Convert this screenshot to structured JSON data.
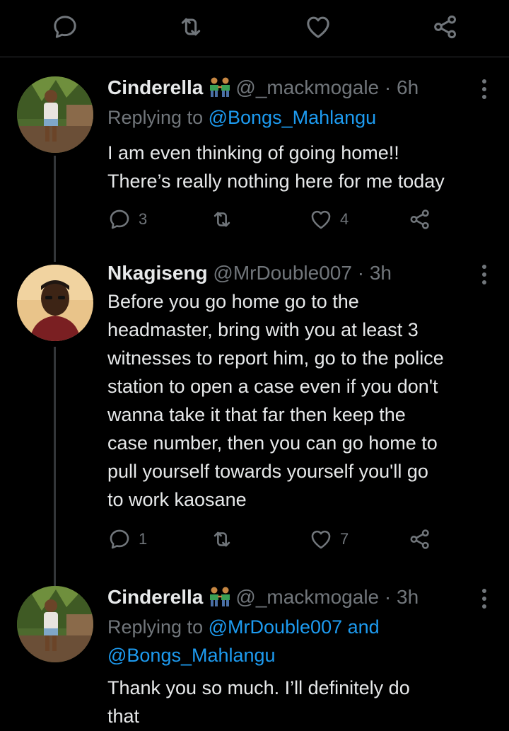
{
  "theme": {
    "background": "#000000",
    "text": "#e7e9ea",
    "muted": "#71767b",
    "link": "#1d9bf0"
  },
  "top_actions": [
    "reply-icon",
    "retweet-icon",
    "like-icon",
    "share-icon"
  ],
  "tweets": [
    {
      "name": "Cinderella",
      "emoji": "couple-emoji",
      "handle": "@_mackmogale",
      "dot": "·",
      "time": "6h",
      "replying_prefix": "Replying to",
      "replying_to": "@Bongs_Mahlangu",
      "text_lines": [
        "I am even thinking of going home!!",
        "There’s really nothing here for me today"
      ],
      "reply_count": "3",
      "like_count": "4"
    },
    {
      "name": "Nkagiseng",
      "handle": "@MrDouble007",
      "dot": "·",
      "time": "3h",
      "text_lines": [
        "Before you go home go to the",
        "headmaster, bring with you at least 3",
        "witnesses to report him, go to the police",
        "station to open a case even if you don't",
        "wanna take it that far then keep the",
        "case number, then you can go home to",
        "pull yourself towards yourself you'll go",
        "to work kaosane"
      ],
      "reply_count": "1",
      "like_count": "7"
    },
    {
      "name": "Cinderella",
      "emoji": "couple-emoji",
      "handle": "@_mackmogale",
      "dot": "·",
      "time": "3h",
      "replying_prefix": "Replying to",
      "replying_to_1": "@MrDouble007 and",
      "replying_to_2": "@Bongs_Mahlangu",
      "text_lines": [
        "Thank you so much. I’ll definitely do",
        "that"
      ]
    }
  ]
}
